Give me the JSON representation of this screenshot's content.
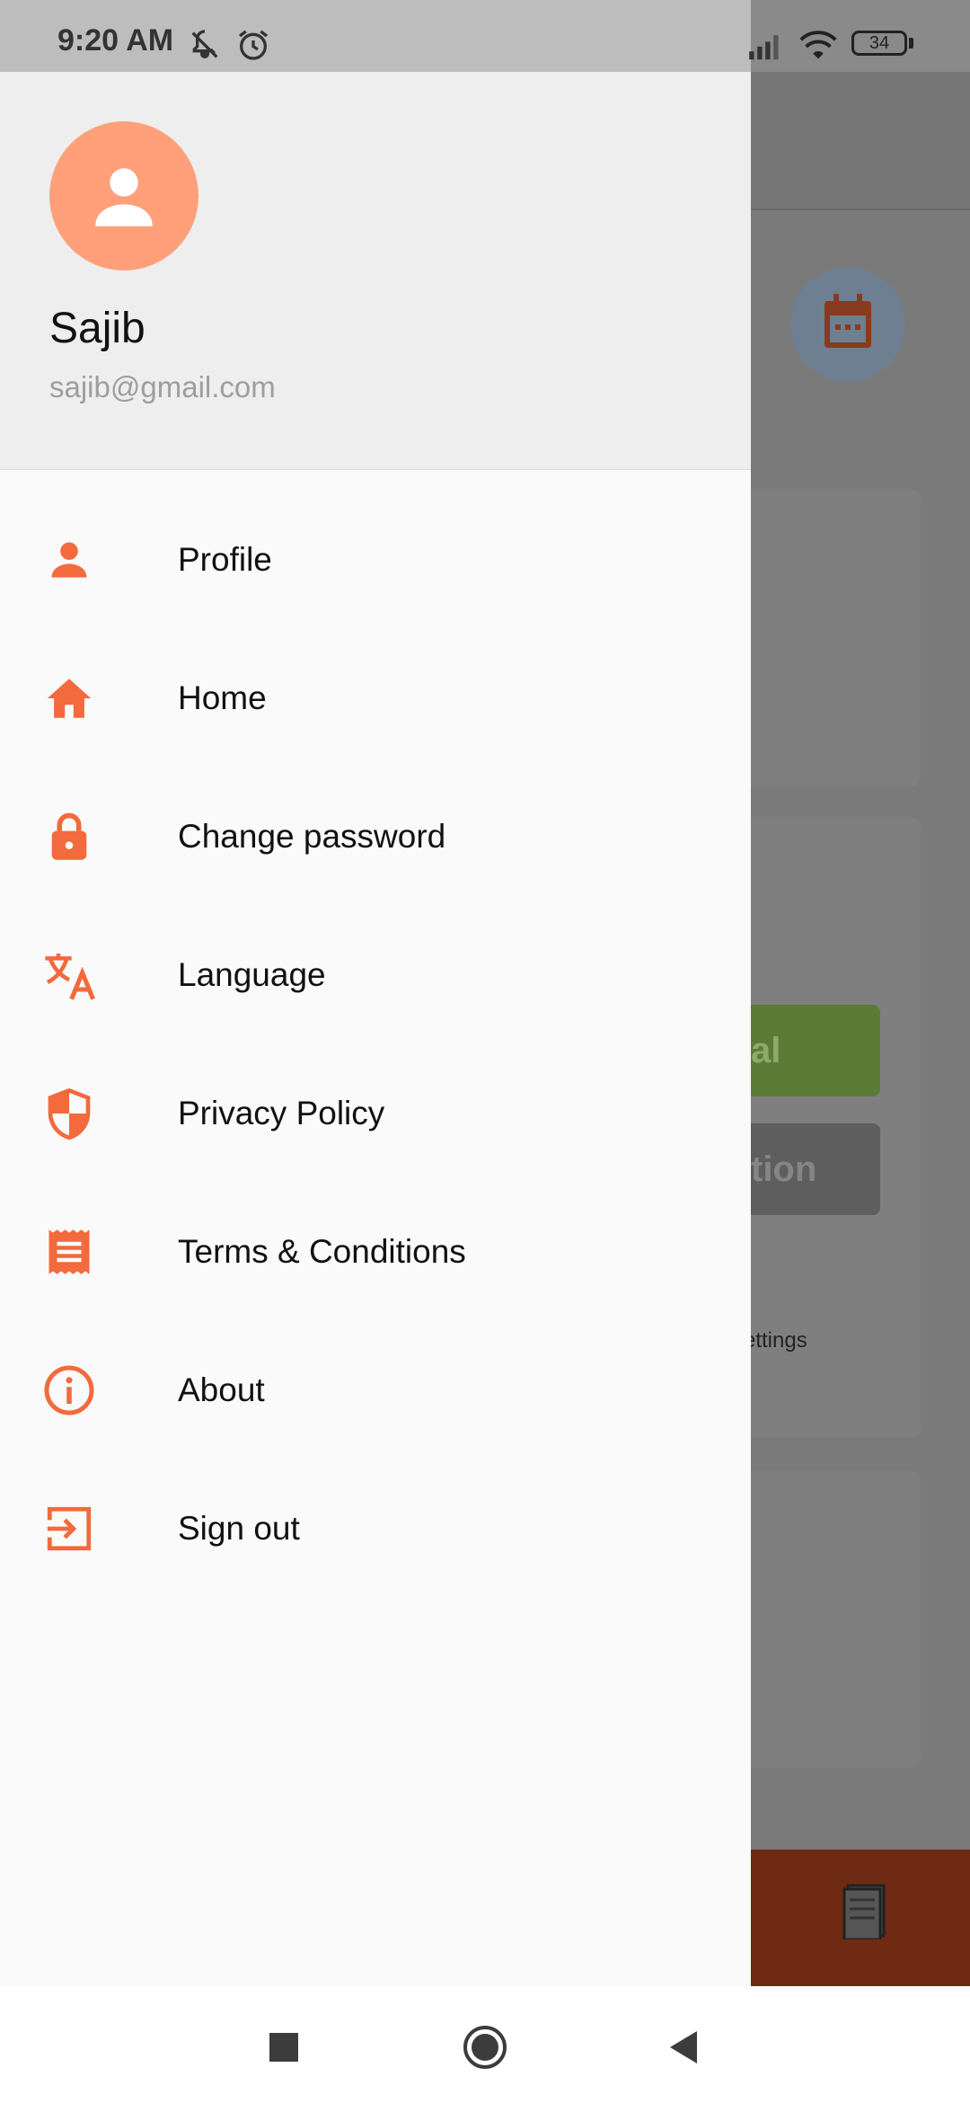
{
  "status_bar": {
    "time": "9:20 AM",
    "battery": "34",
    "icons": [
      "mute-icon",
      "alarm-icon",
      "signal-icon",
      "wifi-icon",
      "battery-icon"
    ]
  },
  "background": {
    "button1_fragment": "al",
    "button2_fragment": "tion",
    "settings_fragment": "ettings"
  },
  "drawer": {
    "header": {
      "name": "Sajib",
      "email": "sajib@gmail.com"
    },
    "accent_color": "#F26A3D",
    "menu": [
      {
        "label": "Profile",
        "icon": "person-icon"
      },
      {
        "label": "Home",
        "icon": "home-icon"
      },
      {
        "label": "Change password",
        "icon": "lock-icon"
      },
      {
        "label": "Language",
        "icon": "translate-icon"
      },
      {
        "label": "Privacy Policy",
        "icon": "shield-icon"
      },
      {
        "label": "Terms & Conditions",
        "icon": "receipt-icon"
      },
      {
        "label": "About",
        "icon": "info-icon"
      },
      {
        "label": "Sign out",
        "icon": "sign-out-icon"
      }
    ]
  },
  "nav_bar": {
    "buttons": [
      "recents-button",
      "home-button",
      "back-button"
    ]
  }
}
